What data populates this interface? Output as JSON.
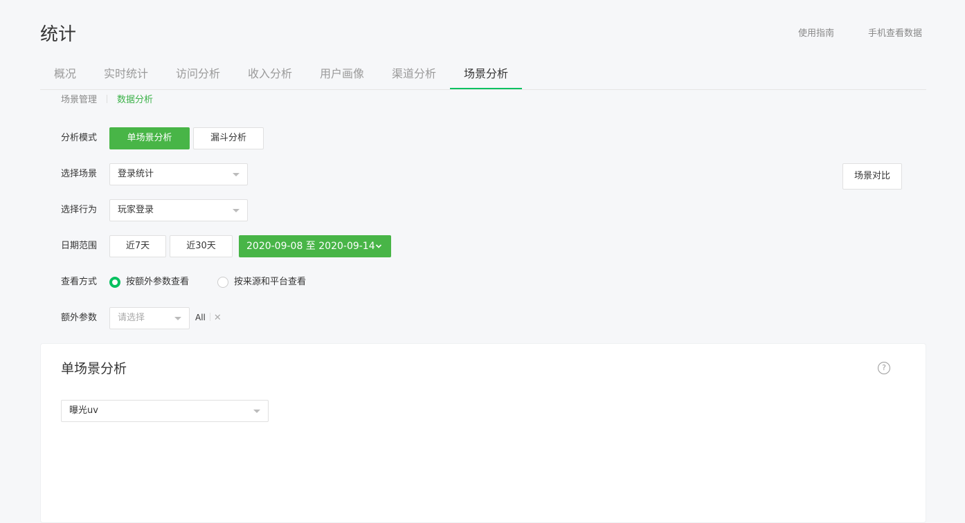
{
  "page": {
    "title": "统计",
    "guide_link": "使用指南",
    "mobile_link": "手机查看数据"
  },
  "tabs": [
    {
      "label": "概况"
    },
    {
      "label": "实时统计"
    },
    {
      "label": "访问分析"
    },
    {
      "label": "收入分析"
    },
    {
      "label": "用户画像"
    },
    {
      "label": "渠道分析"
    },
    {
      "label": "场景分析",
      "active": true
    }
  ],
  "subnav": {
    "manage": "场景管理",
    "analysis": "数据分析"
  },
  "filters": {
    "mode_label": "分析模式",
    "mode_single": "单场景分析",
    "mode_funnel": "漏斗分析",
    "scene_label": "选择场景",
    "scene_value": "登录统计",
    "compare_button": "场景对比",
    "action_label": "选择行为",
    "action_value": "玩家登录",
    "date_label": "日期范围",
    "date_7": "近7天",
    "date_30": "近30天",
    "date_range": "2020-09-08 至 2020-09-14",
    "view_label": "查看方式",
    "view_extra": "按额外参数查看",
    "view_source": "按来源和平台查看",
    "extra_label": "额外参数",
    "extra_placeholder": "请选择",
    "extra_tag": "All"
  },
  "card": {
    "title": "单场景分析",
    "help": "?",
    "metric_value": "曝光uv"
  },
  "colors": {
    "accent": "#48b547",
    "tab_underline": "#07c160",
    "background": "#f6f7f9"
  },
  "icons": {
    "help": "question-circle-icon",
    "dropdown": "caret-down-icon",
    "date_chevron": "chevron-down-icon",
    "remove_tag": "close-icon"
  }
}
